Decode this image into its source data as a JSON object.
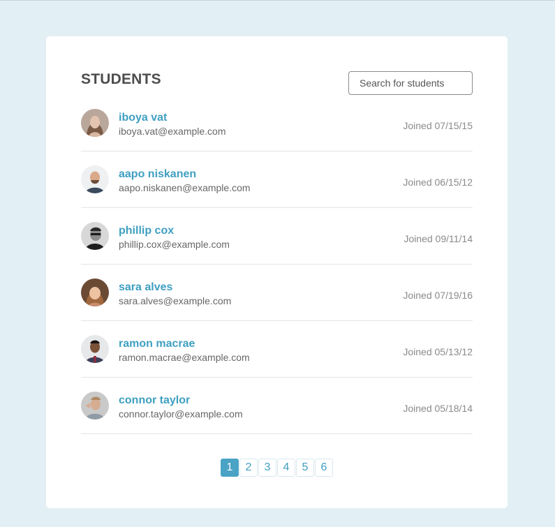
{
  "header": {
    "title": "STUDENTS",
    "search_placeholder": "Search for students"
  },
  "students": [
    {
      "name": "iboya vat",
      "email": "iboya.vat@example.com",
      "joined": "Joined 07/15/15",
      "avatar": "avatar-photo"
    },
    {
      "name": "aapo niskanen",
      "email": "aapo.niskanen@example.com",
      "joined": "Joined 06/15/12",
      "avatar": "avatar-photo"
    },
    {
      "name": "phillip cox",
      "email": "phillip.cox@example.com",
      "joined": "Joined 09/11/14",
      "avatar": "avatar-photo"
    },
    {
      "name": "sara alves",
      "email": "sara.alves@example.com",
      "joined": "Joined 07/19/16",
      "avatar": "avatar-photo"
    },
    {
      "name": "ramon macrae",
      "email": "ramon.macrae@example.com",
      "joined": "Joined 05/13/12",
      "avatar": "avatar-photo"
    },
    {
      "name": "connor taylor",
      "email": "connor.taylor@example.com",
      "joined": "Joined 05/18/14",
      "avatar": "avatar-photo"
    }
  ],
  "pagination": {
    "pages": [
      "1",
      "2",
      "3",
      "4",
      "5",
      "6"
    ],
    "current": "1"
  },
  "colors": {
    "background": "#e2f0f5",
    "accent": "#3f9fc1",
    "active_page": "#4aa3c4",
    "title": "#4d4d4d"
  }
}
